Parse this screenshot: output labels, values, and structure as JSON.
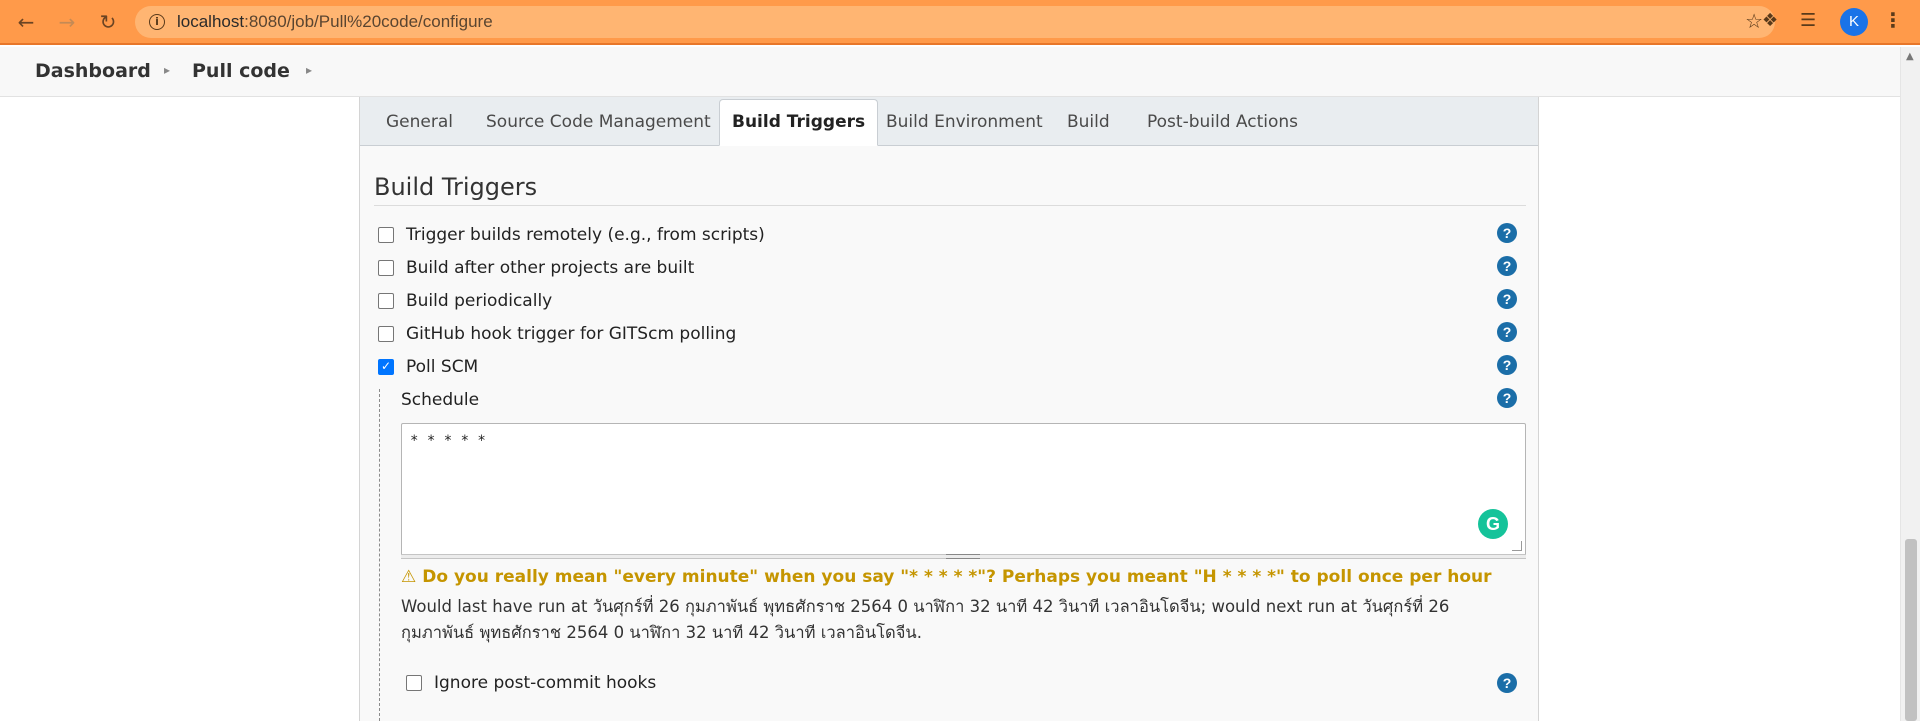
{
  "browser": {
    "url_host": "localhost",
    "url_path": ":8080/job/Pull%20code/configure",
    "avatar_letter": "K",
    "accent_color": "#ff9a4a"
  },
  "breadcrumb": {
    "items": [
      "Dashboard",
      "Pull code"
    ]
  },
  "tabs": [
    {
      "label": "General",
      "active": false
    },
    {
      "label": "Source Code Management",
      "active": false
    },
    {
      "label": "Build Triggers",
      "active": true
    },
    {
      "label": "Build Environment",
      "active": false
    },
    {
      "label": "Build",
      "active": false
    },
    {
      "label": "Post-build Actions",
      "active": false
    }
  ],
  "section": {
    "title": "Build Triggers"
  },
  "triggers": [
    {
      "label": "Trigger builds remotely (e.g., from scripts)",
      "checked": false
    },
    {
      "label": "Build after other projects are built",
      "checked": false
    },
    {
      "label": "Build periodically",
      "checked": false
    },
    {
      "label": "GitHub hook trigger for GITScm polling",
      "checked": false
    },
    {
      "label": "Poll SCM",
      "checked": true
    }
  ],
  "schedule": {
    "label": "Schedule",
    "value": "* * * * *",
    "warning": "Do you really mean \"every minute\" when you say \"* * * * *\"? Perhaps you meant \"H * * * *\" to poll once per hour",
    "explanation": "Would last have run at วันศุกร์ที่ 26 กุมภาพันธ์ พุทธศักราช 2564 0 นาฬิกา 32 นาที 42 วินาที เวลาอินโดจีน; would next run at วันศุกร์ที่ 26 กุมภาพันธ์ พุทธศักราช 2564 0 นาฬิกา 32 นาที 42 วินาที เวลาอินโดจีน."
  },
  "ignore_hooks": {
    "label": "Ignore post-commit hooks",
    "checked": false
  },
  "icons": {
    "help": "?",
    "warning": "⚠",
    "grammarly": "G",
    "check": "✓"
  }
}
